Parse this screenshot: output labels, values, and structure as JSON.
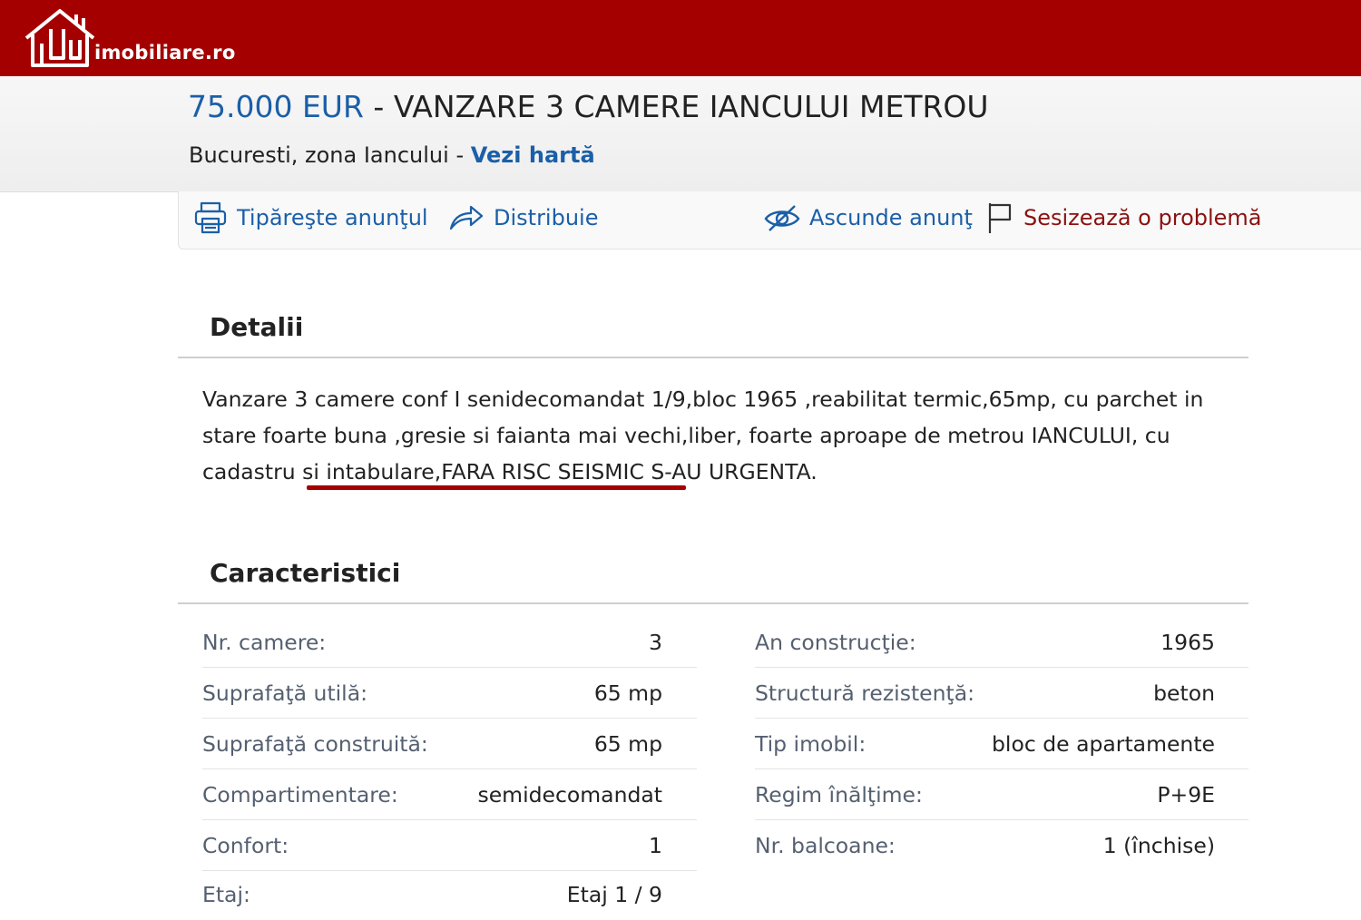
{
  "brand": {
    "logo_text": "imobiliare.ro"
  },
  "listing": {
    "price": "75.000 EUR",
    "separator": "-",
    "title": "VANZARE 3 CAMERE IANCULUI METROU",
    "location": "Bucuresti, zona Iancului",
    "location_separator": "-",
    "map_link": "Vezi hartă"
  },
  "actions": {
    "print": "Tipăreşte anunţul",
    "share": "Distribuie",
    "hide": "Ascunde anunţ",
    "report": "Sesizează o problemă"
  },
  "details": {
    "heading": "Detalii",
    "description": "Vanzare 3 camere conf I senidecomandat 1/9,bloc 1965 ,reabilitat termic,65mp, cu parchet in stare foarte buna ,gresie si faianta mai vechi,liber, foarte aproape de metrou IANCULUI, cu cadastru si intabulare,FARA RISC SEISMIC S-AU URGENTA."
  },
  "characteristics": {
    "heading": "Caracteristici",
    "left": [
      {
        "label": "Nr. camere:",
        "value": "3"
      },
      {
        "label": "Suprafaţă utilă:",
        "value": "65 mp"
      },
      {
        "label": "Suprafaţă construită:",
        "value": "65 mp"
      },
      {
        "label": "Compartimentare:",
        "value": "semidecomandat"
      },
      {
        "label": "Confort:",
        "value": "1"
      },
      {
        "label": "Etaj:",
        "value": "Etaj 1 / 9"
      }
    ],
    "right": [
      {
        "label": "An construcţie:",
        "value": "1965"
      },
      {
        "label": "Structură rezistenţă:",
        "value": "beton"
      },
      {
        "label": "Tip imobil:",
        "value": "bloc de apartamente"
      },
      {
        "label": "Regim înălţime:",
        "value": "P+9E"
      },
      {
        "label": "Nr. balcoane:",
        "value": "1 (închise)"
      }
    ]
  },
  "colors": {
    "brand_red": "#a50000",
    "link_blue": "#1b5fa8",
    "report_red": "#8b1111"
  }
}
